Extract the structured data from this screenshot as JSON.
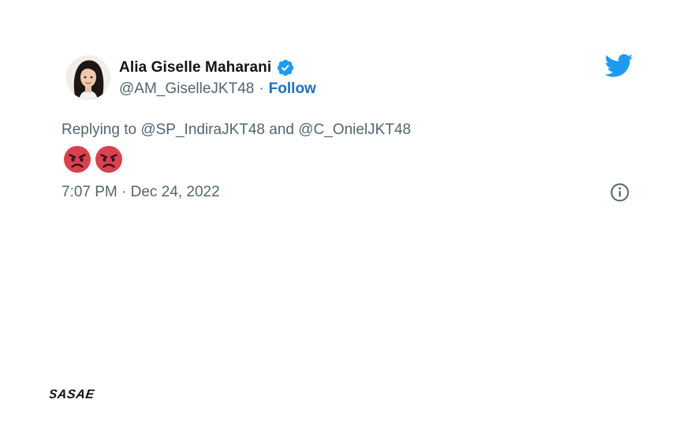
{
  "tweet": {
    "display_name": "Alia Giselle Maharani",
    "handle": "@AM_GiselleJKT48",
    "separator": "·",
    "follow_label": "Follow",
    "reply_prefix": "Replying to",
    "reply_to_1": "@SP_IndiraJKT48",
    "reply_joiner": "and",
    "reply_to_2": "@C_OnielJKT48",
    "emojis": [
      "pouting-face-emoji",
      "pouting-face-emoji"
    ],
    "timestamp": "7:07 PM · Dec 24, 2022"
  },
  "icons": {
    "verified": "verified-badge-icon",
    "twitter": "twitter-bird-icon",
    "info": "info-icon"
  },
  "watermark": {
    "text": "SASAE"
  },
  "colors": {
    "twitter_blue": "#1d9bf0",
    "follow_blue": "#1d6fc4",
    "secondary_text": "#536471",
    "primary_text": "#0f1419",
    "emoji_red": "#d9414e"
  }
}
